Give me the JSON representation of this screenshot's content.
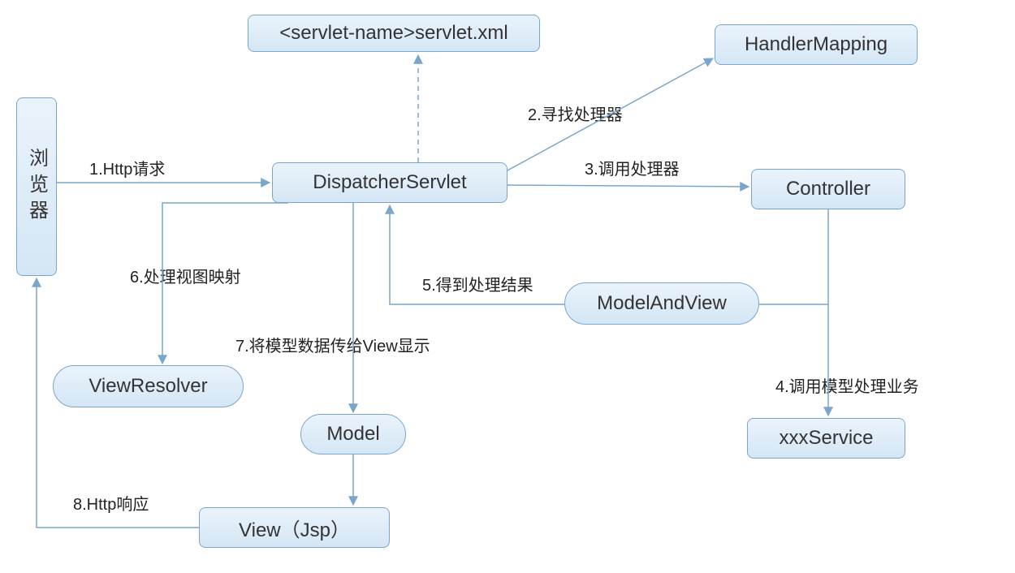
{
  "nodes": {
    "browser": "浏览器",
    "servletXml": "<servlet-name>servlet.xml",
    "handlerMapping": "HandlerMapping",
    "dispatcher": "DispatcherServlet",
    "controller": "Controller",
    "modelAndView": "ModelAndView",
    "viewResolver": "ViewResolver",
    "model": "Model",
    "viewJsp": "View（Jsp）",
    "xxxService": "xxxService"
  },
  "edges": {
    "e1": "1.Http请求",
    "e2": "2.寻找处理器",
    "e3": "3.调用处理器",
    "e4": "4.调用模型处理业务",
    "e5": "5.得到处理结果",
    "e6": "6.处理视图映射",
    "e7": "7.将模型数据传给View显示",
    "e8": "8.Http响应"
  },
  "colors": {
    "stroke": "#7aa6cc",
    "fillTop": "#eaf3fb",
    "fillBottom": "#d4e6f5"
  }
}
